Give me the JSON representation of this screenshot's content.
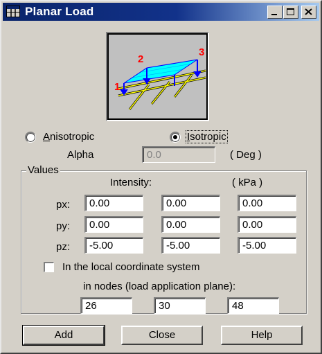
{
  "window": {
    "title": "Planar Load",
    "icon": "grid-app-icon",
    "controls": [
      "minimize-icon",
      "maximize-icon",
      "close-icon"
    ]
  },
  "preview": {
    "node_labels": [
      "1",
      "2",
      "3"
    ],
    "colors": {
      "plane": "#00ffff",
      "beams": "#ffff00",
      "supports": "#0000ff",
      "labels": "#ff0000"
    }
  },
  "mode": {
    "anisotropic_label": "Anisotropic",
    "isotropic_label": "Isotropic",
    "selected": "Isotropic"
  },
  "alpha": {
    "label": "Alpha",
    "value": "0.0",
    "unit": "( Deg )"
  },
  "values": {
    "group_label": "Values",
    "intensity_label": "Intensity:",
    "unit": "( kPa )",
    "rows": [
      {
        "label": "px:",
        "v1": "0.00",
        "v2": "0.00",
        "v3": "0.00"
      },
      {
        "label": "py:",
        "v1": "0.00",
        "v2": "0.00",
        "v3": "0.00"
      },
      {
        "label": "pz:",
        "v1": "-5.00",
        "v2": "-5.00",
        "v3": "-5.00"
      }
    ],
    "local_cs_label": "In the local coordinate system",
    "local_cs_checked": false,
    "nodes_label": "in nodes (load application plane):",
    "nodes": [
      "26",
      "30",
      "48"
    ]
  },
  "buttons": {
    "add": "Add",
    "close": "Close",
    "help": "Help"
  }
}
